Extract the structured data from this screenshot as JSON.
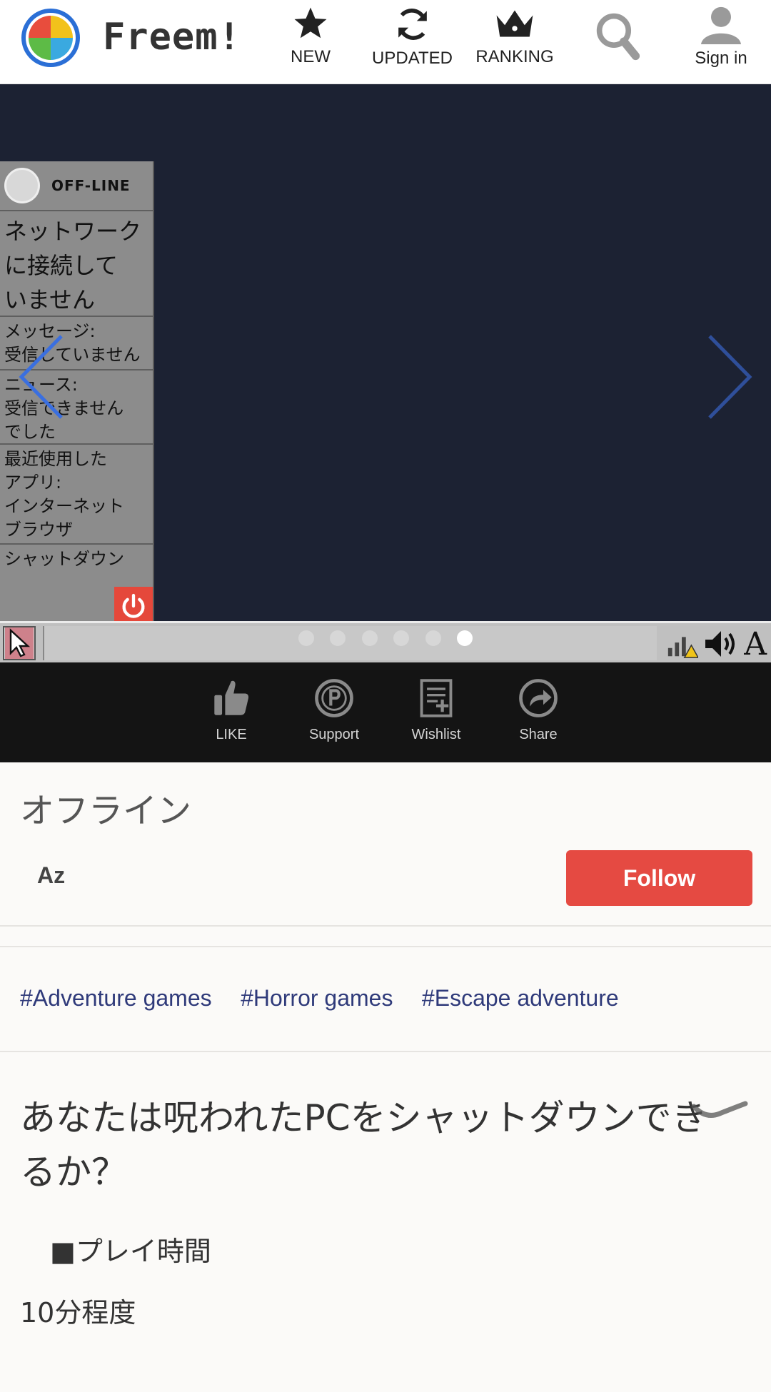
{
  "header": {
    "brand": "Freem!",
    "nav": {
      "new": "NEW",
      "updated": "UPDATED",
      "ranking": "RANKING",
      "signin": "Sign in"
    }
  },
  "slider": {
    "screenshot": {
      "status": "OFF-LINE",
      "network_lines": [
        "ネットワーク",
        "に接続して",
        "いません"
      ],
      "message_lines": [
        "メッセージ:",
        "受信していません"
      ],
      "news_lines": [
        "ニュース:",
        "受信できません",
        "でした"
      ],
      "recent_lines": [
        "最近使用した",
        "アプリ:",
        "インターネット",
        "ブラウザ"
      ],
      "shutdown": "シャットダウン",
      "taskbar_letter": "A"
    },
    "dots_total": 6,
    "active_dot": 6
  },
  "actions": {
    "like": "LIKE",
    "support": "Support",
    "wishlist": "Wishlist",
    "share": "Share"
  },
  "game": {
    "title": "オフライン",
    "author": "Az",
    "follow_label": "Follow",
    "tags": [
      "#Adventure games",
      "#Horror games",
      "#Escape adventure"
    ],
    "heading_lines": [
      "あなたは呪われたPCをシャットダウンでき",
      "るか？"
    ],
    "playtime_label": "■プレイ時間",
    "playtime_value": "10分程度"
  },
  "colors": {
    "accent": "#e54a42",
    "tag": "#2f3a7a",
    "slider_bg": "#1c2233",
    "action_bar": "#141414"
  }
}
